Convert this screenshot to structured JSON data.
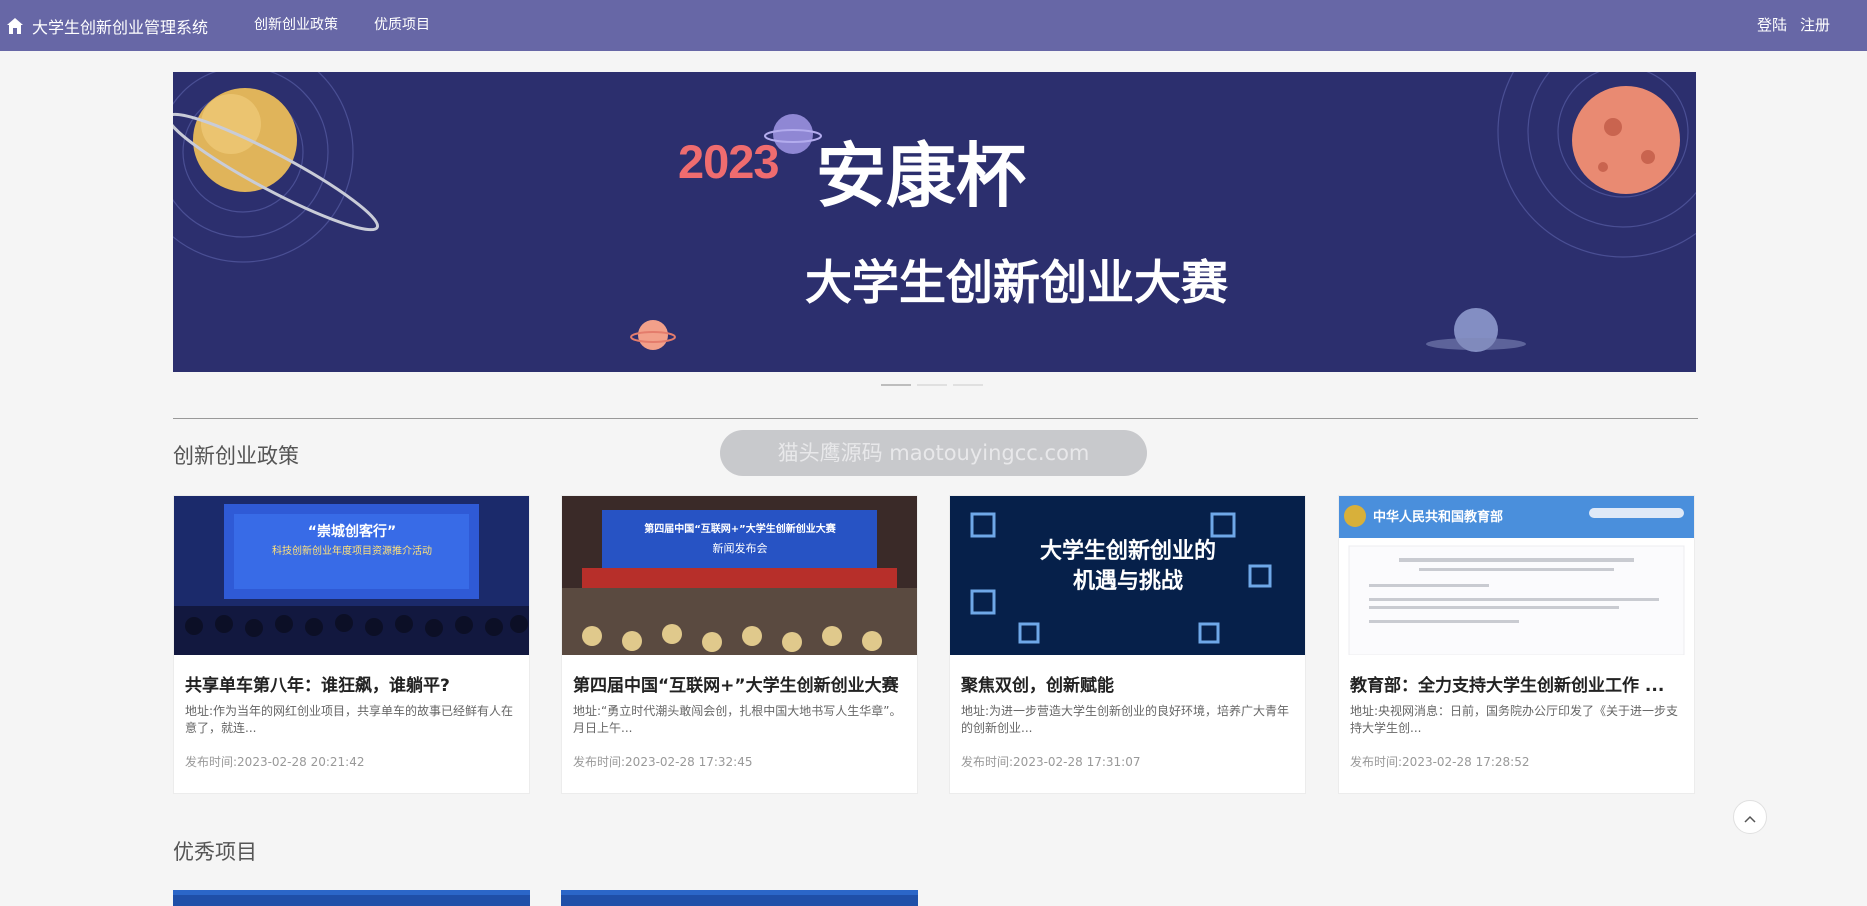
{
  "nav": {
    "brand_icon": "home-icon",
    "brand_title": "大学生创新创业管理系统",
    "links": [
      "创新创业政策",
      "优质项目"
    ],
    "login": "登陆",
    "register": "注册"
  },
  "banner": {
    "year": "2023",
    "cup": "安康杯",
    "contest": "大学生创新创业大赛",
    "slides": 3,
    "active_slide": 0
  },
  "watermark": "猫头鹰源码 maotouyingcc.com",
  "policy": {
    "title": "创新创业政策",
    "cards": [
      {
        "thumb_title": "“崇城创客行”",
        "thumb_sub": "科技创新创业年度项目资源推介活动",
        "title": "共享单车第八年：谁狂飙，谁躺平?",
        "summary": "地址:作为当年的网红创业项目，共享单车的故事已经鲜有人在意了，就连...",
        "date": "发布时间:2023-02-28 20:21:42"
      },
      {
        "thumb_title": "第四届中国“互联网+”大学生创新创业大赛",
        "thumb_sub": "新闻发布会",
        "title": "第四届中国“互联网+”大学生创新创业大赛",
        "summary": "地址:“勇立时代潮头敢闯会创，扎根中国大地书写人生华章”。月日上午...",
        "date": "发布时间:2023-02-28 17:32:45"
      },
      {
        "thumb_title": "大学生创新创业的",
        "thumb_sub": "机遇与挑战",
        "title": "聚焦双创，创新赋能",
        "summary": "地址:为进一步营造大学生创新创业的良好环境，培养广大青年的创新创业...",
        "date": "发布时间:2023-02-28 17:31:07"
      },
      {
        "thumb_title": "中华人民共和国教育部",
        "thumb_sub": "",
        "title": "教育部：全力支持大学生创新创业工作 ...",
        "summary": "地址:央视网消息：日前，国务院办公厅印发了《关于进一步支持大学生创...",
        "date": "发布时间:2023-02-28 17:28:52"
      }
    ]
  },
  "projects": {
    "title": "优秀项目"
  },
  "back_to_top_icon": "chevron-up-icon"
}
